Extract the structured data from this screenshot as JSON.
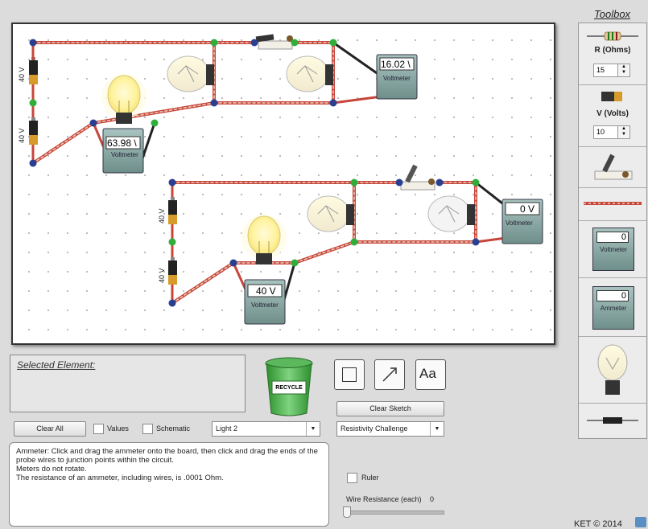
{
  "toolbox": {
    "title": "Toolbox",
    "resistor_label": "R (Ohms)",
    "resistor_value": "15",
    "battery_label": "V (Volts)",
    "battery_value": "10",
    "voltmeter_reading": "0",
    "voltmeter_label": "Voltmeter",
    "ammeter_reading": "0",
    "ammeter_label": "Ammeter"
  },
  "board": {
    "battery_labels": [
      "40 V",
      "40 V",
      "40 V",
      "40 V"
    ],
    "meters": [
      {
        "reading": "63.98 \\",
        "label": "Voltmeter"
      },
      {
        "reading": "16.02 \\",
        "label": "Voltmeter"
      },
      {
        "reading": "40 V",
        "label": "Voltmeter"
      },
      {
        "reading": "0 V",
        "label": "Voltmeter"
      }
    ]
  },
  "selected": {
    "title": "Selected Element:"
  },
  "recycle": {
    "label": "RECYCLE"
  },
  "controls": {
    "clear_all": "Clear All",
    "values_label": "Values",
    "schematic_label": "Schematic",
    "light_select": "Light 2",
    "clear_sketch": "Clear Sketch",
    "text_tool": "Aa",
    "challenge_select": "Resistivity Challenge",
    "ruler_label": "Ruler",
    "wire_resistance_label": "Wire Resistance (each)",
    "wire_resistance_value": "0"
  },
  "help": {
    "lines": [
      "Ammeter: Click and drag the ammeter onto the board, then click and drag the ends of the probe wires to junction points within the circuit.",
      "Meters do not rotate.",
      "The resistance of an ammeter, including wires, is .0001 Ohm."
    ]
  },
  "footer": {
    "copyright": "KET © 2014"
  }
}
